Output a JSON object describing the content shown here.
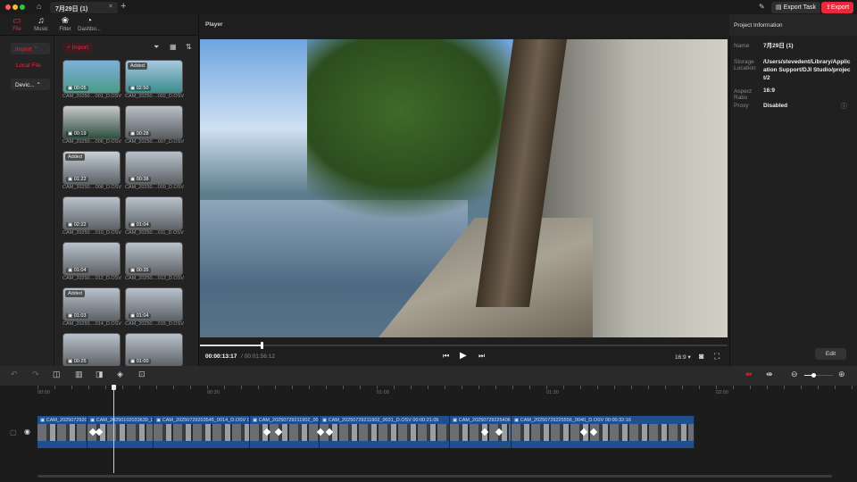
{
  "window": {
    "tab_title": "7月29日 (1)",
    "export_task": "Export Task",
    "export": "Export"
  },
  "nav": [
    {
      "label": "File",
      "icon": "folder-icon"
    },
    {
      "label": "Music",
      "icon": "music-icon"
    },
    {
      "label": "Filter",
      "icon": "filter-icon"
    },
    {
      "label": "Dashbo...",
      "icon": "dashboard-icon"
    }
  ],
  "sidebar": {
    "import": "Import",
    "local_file": "Local File",
    "device": "Devic..."
  },
  "media": {
    "import_button": "+ Import",
    "items": [
      {
        "name": "CAM_20250....001_D.OSV",
        "duration": "00:05",
        "added": false
      },
      {
        "name": "CAM_20250....002_D.OSV",
        "duration": "02:50",
        "added": true
      },
      {
        "name": "CAM_20250....006_D.OSV",
        "duration": "00:19",
        "added": false
      },
      {
        "name": "CAM_20250....007_D.OSV",
        "duration": "00:28",
        "added": false
      },
      {
        "name": "CAM_20250....008_D.OSV",
        "duration": "01:22",
        "added": true
      },
      {
        "name": "CAM_20250....009_D.OSV",
        "duration": "00:38",
        "added": false
      },
      {
        "name": "CAM_20250....010_D.OSV",
        "duration": "02:22",
        "added": false
      },
      {
        "name": "CAM_20250....011_D.OSV",
        "duration": "01:04",
        "added": false
      },
      {
        "name": "CAM_20250....012_D.OSV",
        "duration": "01:04",
        "added": false
      },
      {
        "name": "CAM_20250....013_D.OSV",
        "duration": "00:35",
        "added": false
      },
      {
        "name": "CAM_20250....014_D.OSV",
        "duration": "01:03",
        "added": true
      },
      {
        "name": "CAM_20250....015_D.OSV",
        "duration": "01:04",
        "added": false
      },
      {
        "name": "",
        "duration": "00:25",
        "added": false
      },
      {
        "name": "",
        "duration": "01:00",
        "added": false
      }
    ],
    "added_label": "Added"
  },
  "player": {
    "title": "Player",
    "current_time": "00:00:13:17",
    "total_time": "/ 00:01:56:12",
    "progress": 0.117,
    "aspect": "16:9"
  },
  "project": {
    "title": "Project Information",
    "name_label": "Name",
    "name": "7月29日 (1)",
    "storage_label": "Storage Location",
    "storage": "/Users/stevedent/Library/Application Support/DJI Studio/project/2",
    "aspect_label": "Aspect Ratio",
    "aspect": "16:9",
    "proxy_label": "Proxy",
    "proxy": "Disabled",
    "edit": "Edit"
  },
  "timeline": {
    "ruler": [
      "00:00",
      "00:30",
      "01:00",
      "01:30",
      "02:00"
    ],
    "clips": [
      "CAM_2025072920",
      "CAM_20250102033639_0",
      "CAM_20250729203545_0014_D.OSV 0",
      "CAM_20250729211902_00",
      "CAM_20250729211902_0031_D.OSV 00:00:21:05",
      "CAM_20250729225406_00",
      "CAM_20250729225556_0040_D.OSV 00:00:32:16"
    ]
  },
  "colors": {
    "accent": "#e8283c",
    "clip": "#1f4f8f"
  }
}
